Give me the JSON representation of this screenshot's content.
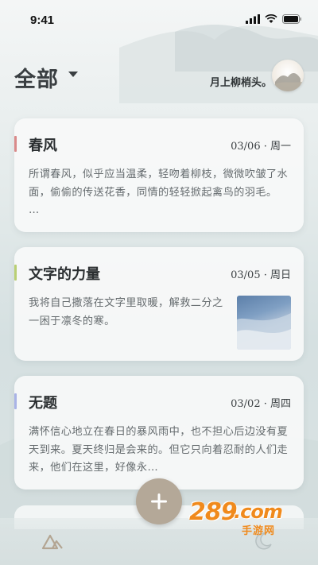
{
  "status_bar": {
    "time": "9:41"
  },
  "header": {
    "title": "全部",
    "user_name": "月上柳梢头。"
  },
  "entries": [
    {
      "title": "春风",
      "date": "03/06 · 周一",
      "excerpt": "所谓春风，似乎应当温柔，轻吻着柳枝，微微吹皱了水面，偷偷的传送花香，同情的轻轻掀起禽鸟的羽毛。 …",
      "accent": "#d98a8a"
    },
    {
      "title": "文字的力量",
      "date": "03/05 · 周日",
      "excerpt": "我将自己撒落在文字里取暖，解救二分之一困于凛冬的寒。",
      "accent": "#b9cf73",
      "has_image": true
    },
    {
      "title": "无题",
      "date": "03/02 · 周四",
      "excerpt": "满怀信心地立在春日的暴风雨中，也不担心后边没有夏天到来。夏天终归是会来的。但它只向着忍耐的人们走来，他们在这里，好像永…",
      "accent": "#a9b3e6"
    }
  ],
  "bottom_nav": {
    "add_label": "+"
  },
  "watermark": {
    "number": "289",
    "suffix": ".com",
    "sub": "手游网"
  },
  "icons": [
    "caret-down-icon",
    "signal-icon",
    "wifi-icon",
    "battery-icon",
    "add-icon",
    "mountain-icon",
    "moon-icon"
  ]
}
